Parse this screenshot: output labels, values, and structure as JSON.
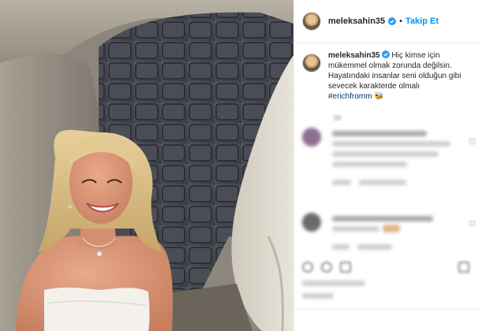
{
  "header": {
    "username": "meleksahin35",
    "separator": "•",
    "follow_label": "Takip Et"
  },
  "caption": {
    "username": "meleksahin35",
    "text": "Hiç kimse için mükemmel olmak zorunda değilsin. Hayatındaki insanlar seni olduğun gibi sevecek karakterde olmalı",
    "hashtag": "#erichfromm",
    "emoji": "🐝"
  },
  "colors": {
    "accent": "#0095f6",
    "hashtag": "#00376b",
    "verified": "#3897f0"
  },
  "icons": [
    "verified-badge-icon",
    "heart-icon",
    "comment-icon",
    "share-icon",
    "bookmark-icon"
  ]
}
